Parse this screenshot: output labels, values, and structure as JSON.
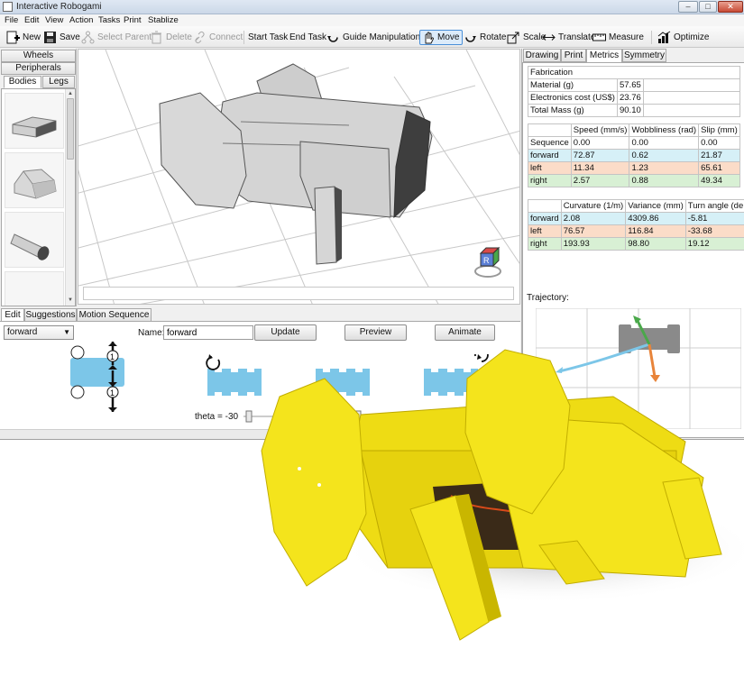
{
  "window": {
    "title": "Interactive Robogami",
    "controls": {
      "minimize": "–",
      "maximize": "□",
      "close": "✕"
    }
  },
  "menu": [
    "File",
    "Edit",
    "View",
    "Action",
    "Tasks",
    "Print",
    "Stablize"
  ],
  "toolbar": {
    "new": "New",
    "save": "Save",
    "select_parent": "Select Parent",
    "delete": "Delete",
    "connect": "Connect",
    "start_task": "Start Task",
    "end_task": "End Task",
    "guide_manipulation": "Guide Manipulation",
    "move": "Move",
    "rotate": "Rotate",
    "scale": "Scale",
    "translate": "Translate",
    "measure": "Measure",
    "optimize": "Optimize"
  },
  "library": {
    "tabs": [
      "Wheels",
      "Peripherals"
    ],
    "subtabs": [
      "Bodies",
      "Legs"
    ],
    "active_subtab": "Bodies"
  },
  "viewport": {
    "view_cube_label": "R"
  },
  "right_panel": {
    "tabs": [
      "Drawing",
      "Print",
      "Metrics",
      "Symmetry"
    ],
    "active_tab": "Metrics",
    "fabrication": {
      "header": "Fabrication",
      "rows": [
        {
          "label": "Material (g)",
          "value": "57.65"
        },
        {
          "label": "Electronics cost (US$)",
          "value": "23.76"
        },
        {
          "label": "Total Mass (g)",
          "value": "90.10"
        }
      ]
    },
    "motion": {
      "headers": [
        "",
        "Speed (mm/s)",
        "Wobbliness (rad)",
        "Slip (mm)"
      ],
      "rows": [
        {
          "name": "Sequence",
          "speed": "0.00",
          "wobble": "0.00",
          "slip": "0.00"
        },
        {
          "name": "forward",
          "speed": "72.87",
          "wobble": "0.62",
          "slip": "21.87"
        },
        {
          "name": "left",
          "speed": "11.34",
          "wobble": "1.23",
          "slip": "65.61"
        },
        {
          "name": "right",
          "speed": "2.57",
          "wobble": "0.88",
          "slip": "49.34"
        }
      ]
    },
    "turning": {
      "headers": [
        "",
        "Curvature (1/m)",
        "Variance (mm)",
        "Turn angle (de"
      ],
      "rows": [
        {
          "name": "forward",
          "curv": "2.08",
          "var": "4309.86",
          "angle": "-5.81"
        },
        {
          "name": "left",
          "curv": "76.57",
          "var": "116.84",
          "angle": "-33.68"
        },
        {
          "name": "right",
          "curv": "193.93",
          "var": "98.80",
          "angle": "19.12"
        }
      ]
    },
    "trajectory_label": "Trajectory:"
  },
  "bottom_panel": {
    "tabs": [
      "Edit",
      "Suggestions",
      "Motion Sequence"
    ],
    "active_tab": "Edit",
    "gait_select": "forward",
    "name_label": "Name:",
    "name_value": "forward",
    "update_button": "Update",
    "preview_button": "Preview",
    "animate_button": "Animate",
    "theta_label": "theta =",
    "theta_value": "-30",
    "leg_markers": [
      "1",
      "1"
    ]
  },
  "colors": {
    "accent": "#4a90d9",
    "gait_blue": "#7cc6e8",
    "robot_yellow": "#f4e41c",
    "forward_row": "#d6f0f7",
    "left_row": "#fbdcc8",
    "right_row": "#d8f0d4"
  }
}
